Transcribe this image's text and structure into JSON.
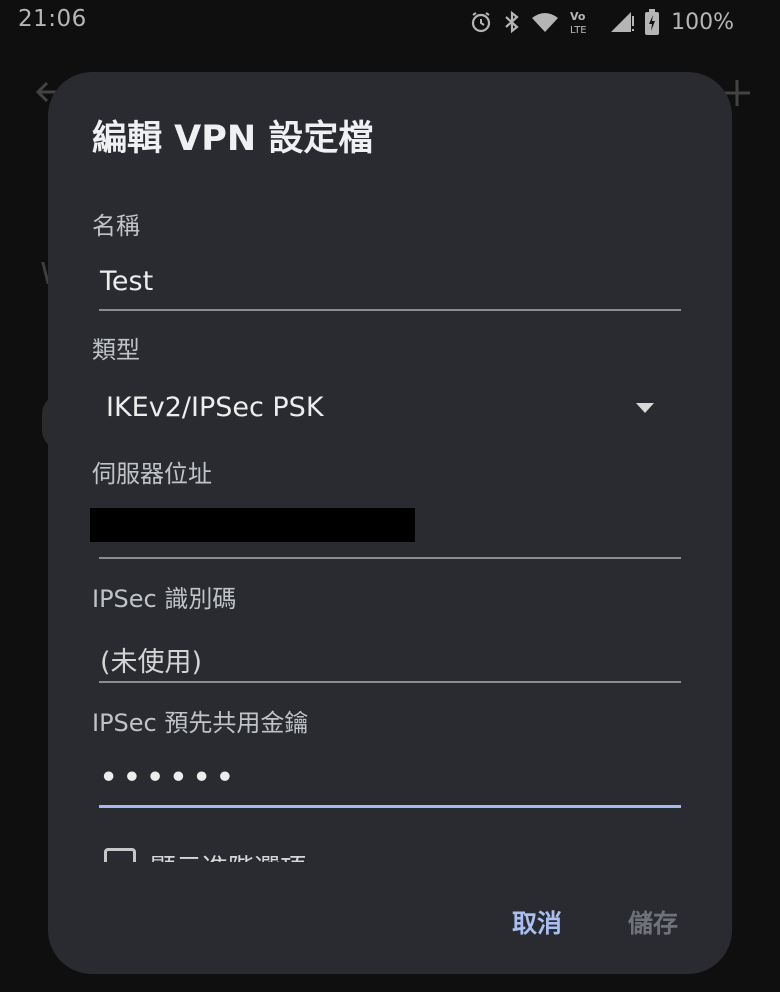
{
  "status_bar": {
    "time": "21:06",
    "battery": "100%",
    "icons": [
      "alarm-icon",
      "bluetooth-icon",
      "wifi-icon",
      "volte-icon",
      "signal-icon",
      "battery-charging-icon"
    ]
  },
  "dialog": {
    "title": "編輯 VPN 設定檔",
    "fields": {
      "name": {
        "label": "名稱",
        "value": "Test"
      },
      "type": {
        "label": "類型",
        "value": "IKEv2/IPSec PSK"
      },
      "server": {
        "label": "伺服器位址",
        "value": ""
      },
      "ipsec_id": {
        "label": "IPSec 識別碼",
        "placeholder": "(未使用)"
      },
      "ipsec_psk": {
        "label": "IPSec 預先共用金鑰",
        "value": "••••••"
      }
    },
    "advanced_checkbox": {
      "label": "顯示進階選項",
      "checked": false
    },
    "buttons": {
      "cancel": "取消",
      "save": "儲存"
    }
  },
  "colors": {
    "dialog_bg": "#2a2b30",
    "accent": "#a9bff0",
    "disabled": "#6f7278"
  }
}
